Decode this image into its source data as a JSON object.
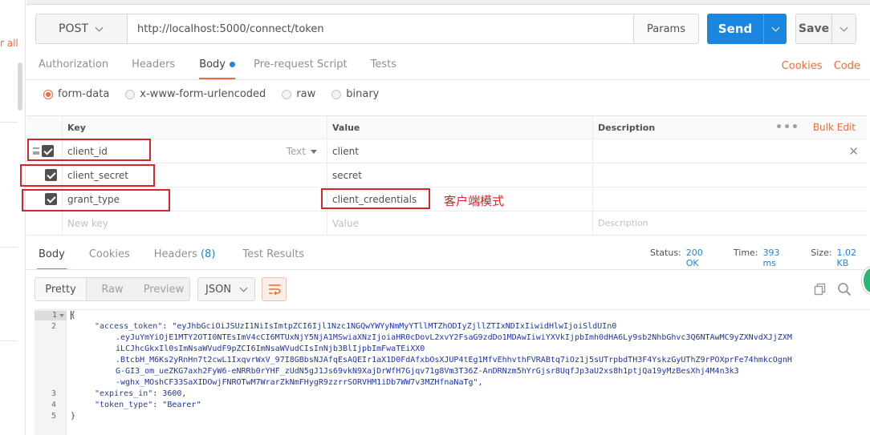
{
  "sidebar": {
    "clear_all": "r all"
  },
  "request": {
    "method": "POST",
    "url": "http://localhost:5000/connect/token",
    "params_label": "Params",
    "send_label": "Send",
    "save_label": "Save"
  },
  "req_tabs": {
    "authorization": "Authorization",
    "headers": "Headers",
    "body": "Body",
    "prerequest": "Pre-request Script",
    "tests": "Tests",
    "cookies": "Cookies",
    "code": "Code"
  },
  "body_modes": {
    "form_data": "form-data",
    "urlencoded": "x-www-form-urlencoded",
    "raw": "raw",
    "binary": "binary"
  },
  "kv_table": {
    "header_key": "Key",
    "header_value": "Value",
    "header_description": "Description",
    "bulk_edit": "Bulk Edit",
    "type_label": "Text",
    "rows": [
      {
        "key": "client_id",
        "value": "client"
      },
      {
        "key": "client_secret",
        "value": "secret"
      },
      {
        "key": "grant_type",
        "value": "client_credentials"
      }
    ],
    "new_key_placeholder": "New key",
    "value_placeholder": "Value",
    "description_placeholder": "Description"
  },
  "annotation": "客户端模式",
  "response": {
    "tabs": {
      "body": "Body",
      "cookies": "Cookies",
      "headers": "Headers",
      "headers_count": "(8)",
      "test_results": "Test Results"
    },
    "status_label": "Status:",
    "status_value": "200 OK",
    "time_label": "Time:",
    "time_value": "393 ms",
    "size_label": "Size:",
    "size_value": "1.02 KB",
    "view_modes": {
      "pretty": "Pretty",
      "raw": "Raw",
      "preview": "Preview"
    },
    "format": "JSON"
  },
  "code": {
    "line_numbers": [
      "1",
      "2",
      "3",
      "4",
      "5"
    ],
    "open_brace": "{",
    "close_brace": "}",
    "access_token_key": "\"access_token\"",
    "access_token_lines": [
      "\"eyJhbGciOiJSUzI1NiIsImtpZCI6Ijl1Nzc1NGQwYWYyNmMyYTllMTZhODIyZjllZTIxNDIxIiwidHlwIjoiSldUIn0",
      ".eyJuYmYiOjE1MTY2OTI0NTEsImV4cCI6MTUxNjY5NjA1MSwiaXNzIjoiaHR0cDovL2xvY2FsaG9zdDo1MDAwIiwiYXVkIjpbImh0dHA6Ly9sb2NhbGhvc3Q6NTAwMC9yZXNvdXJjZXM",
      "iLCJhcGkxIl0sImNsaWVudF9pZCI6ImNsaWVudCIsInNjb3BlIjpbImFwaTEiXX0",
      ".BtcbH_M6Ks2yRnHn7t2cwL1IxqvrWxV_97I8GBbsNJAfqEsAQEIr1aX1D0FdAfxbOsXJUP4tEg1MfvEhhvthFVRABtq7iOz1j5sUTrpbdTH3F4YskzGyUThZ9rPOXprFe74hmkcOgnH",
      "G-GI3_om_ueZKG7axh2FyW6-eNRRb0rYHF_zUdN5gJ1Js69vkN9XajDrWfH7Gjqv71g8Vm3T36Z-AnDRNzm5hYrGjsr8UqfJp3aU2xs8h1ptjQa19yMzBesXhj4M4n3k3",
      "-wghx_MOshCF33SaXIDOwjFNROTwM7WrarZkNmFHygR9zzrrSORVHM1iDb7WW7v3MZHfnaNaTg\","
    ],
    "expires_key": "\"expires_in\"",
    "expires_value": "3600,",
    "token_type_key": "\"token_type\"",
    "token_type_value": "\"Bearer\""
  },
  "colors": {
    "accent": "#f26b3a",
    "send_blue": "#1a86e0",
    "annotation_red": "#d6262b",
    "token_blue": "#1e33b4"
  },
  "icons": {
    "method_dropdown": "chevron-down-icon",
    "send_dropdown": "chevron-down-icon",
    "save_dropdown": "chevron-down-icon",
    "wrap": "wrap-lines-icon",
    "copy": "copy-icon",
    "search": "search-icon",
    "remove_row": "close-icon",
    "drag": "drag-handle-icon"
  }
}
